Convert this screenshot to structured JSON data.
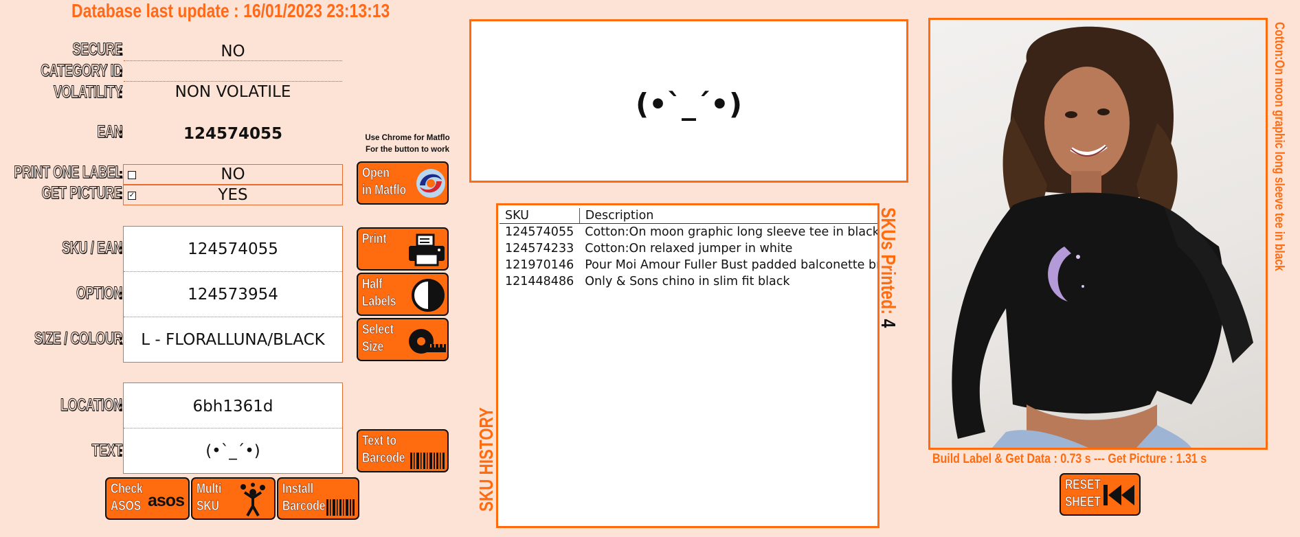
{
  "header": {
    "db_update": "Database last update : 16/01/2023 23:13:13"
  },
  "fields": {
    "secure": {
      "label": "SECURE",
      "value": "NO"
    },
    "category_id": {
      "label": "CATEGORY ID",
      "value": ""
    },
    "volatility": {
      "label": "VOLATILITY",
      "value": "NON VOLATILE"
    },
    "ean": {
      "label": "EAN",
      "value": "124574055"
    },
    "print_one_label": {
      "label": "PRINT ONE LABEL",
      "value": "NO",
      "checked": false
    },
    "get_picture": {
      "label": "GET PICTURE",
      "value": "YES",
      "checked": true
    },
    "sku_ean": {
      "label": "SKU / EAN",
      "value": "124574055"
    },
    "option": {
      "label": "OPTION",
      "value": "124573954"
    },
    "size_colour": {
      "label": "SIZE / COLOUR",
      "value": "L - FLORALLUNA/BLACK"
    },
    "location": {
      "label": "LOCATION",
      "value": "6bh1361d"
    },
    "text": {
      "label": "TEXT",
      "value": "(•`_´•)"
    }
  },
  "colon": ":",
  "chrome_note": {
    "line1": "Use Chrome for Matflo",
    "line2": "For the button to work"
  },
  "buttons": {
    "open_matflo": "Open\nin Matflo",
    "print": "Print",
    "half_labels": "Half\nLabels",
    "select_size": "Select\nSize",
    "text_to_barcode": "Text to\nBarcode",
    "check_asos": "Check\nASOS",
    "asos_logo": "asos",
    "multi_sku": "Multi\nSKU",
    "install_barcode": "Install\nBarcode",
    "reset_sheet": "RESET\nSHEET"
  },
  "emoticon": "(•`_´•)",
  "history": {
    "title": "SKU HISTORY",
    "columns": [
      "SKU",
      "Description"
    ],
    "rows": [
      [
        "124574055",
        "Cotton:On moon graphic long sleeve tee in black"
      ],
      [
        "124574233",
        "Cotton:On relaxed jumper in white"
      ],
      [
        "121970146",
        "Pour Moi Amour Fuller Bust padded balconette bra in"
      ],
      [
        "121448486",
        "Only & Sons chino in slim fit black"
      ]
    ]
  },
  "skus_printed": {
    "label": "SKUs Printed:",
    "count": "4"
  },
  "picture_caption": "Cotton:On moon graphic long sleeve tee in black",
  "timing": "Build Label & Get Data : 0.73 s   ---   Get Picture : 1.31 s",
  "colors": {
    "accent": "#ff6b0f",
    "background": "#fde3d6",
    "header": "#ff6a1a"
  }
}
